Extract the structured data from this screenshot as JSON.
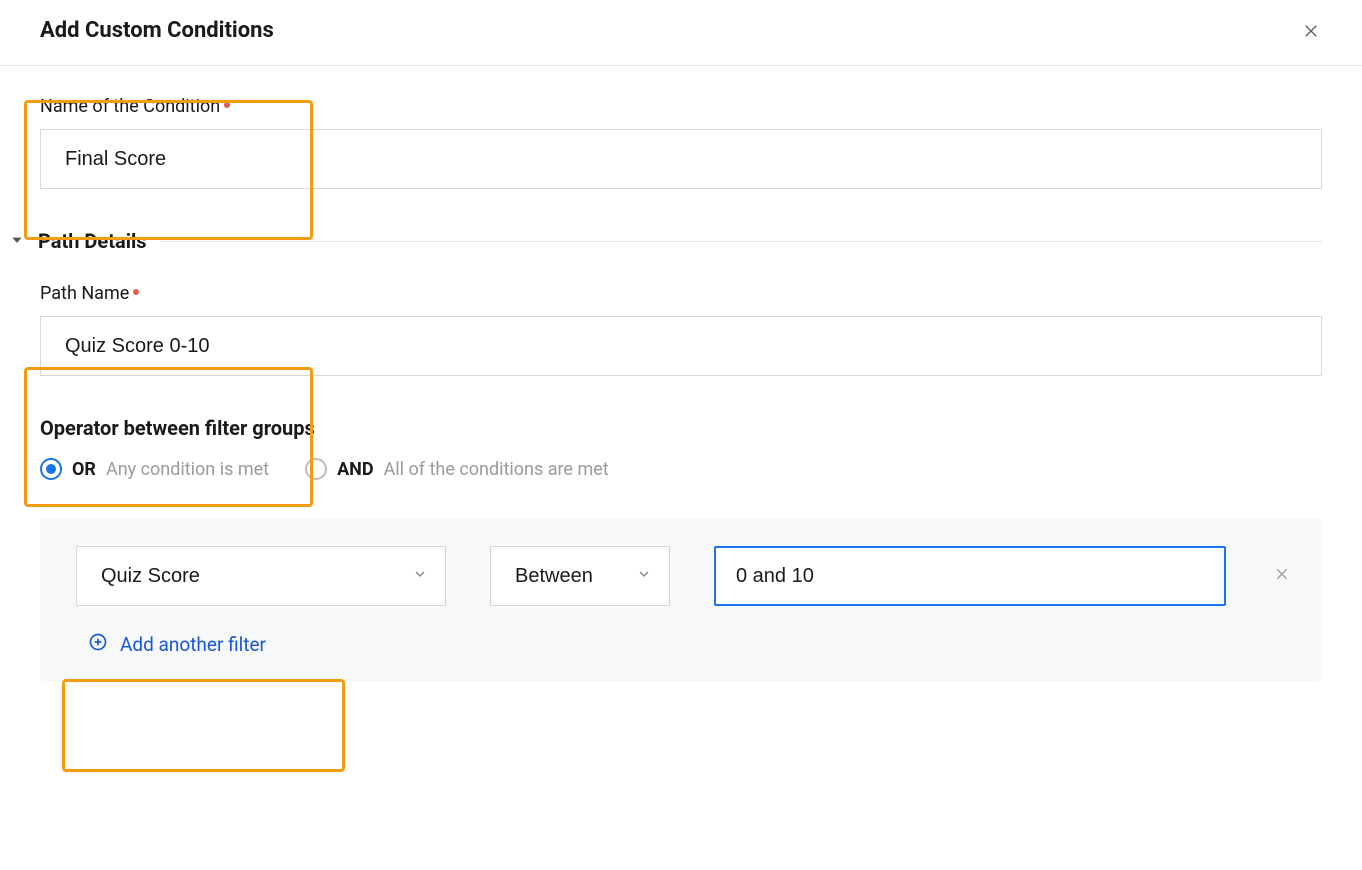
{
  "header": {
    "title": "Add Custom Conditions"
  },
  "condition_name": {
    "label": "Name of the Condition",
    "value": "Final Score"
  },
  "path_details": {
    "section_title": "Path Details",
    "path_name": {
      "label": "Path Name",
      "value": "Quiz Score 0-10"
    }
  },
  "operator_group": {
    "title": "Operator between filter groups",
    "options": {
      "or": {
        "label": "OR",
        "desc": "Any condition is met",
        "selected": true
      },
      "and": {
        "label": "AND",
        "desc": "All of the conditions are met",
        "selected": false
      }
    }
  },
  "filter": {
    "field": "Quiz Score",
    "operator": "Between",
    "value": "0 and 10",
    "add_another": "Add another filter"
  },
  "colors": {
    "highlight": "#f39c12",
    "primary": "#1a73e8",
    "link": "#1a56db"
  }
}
